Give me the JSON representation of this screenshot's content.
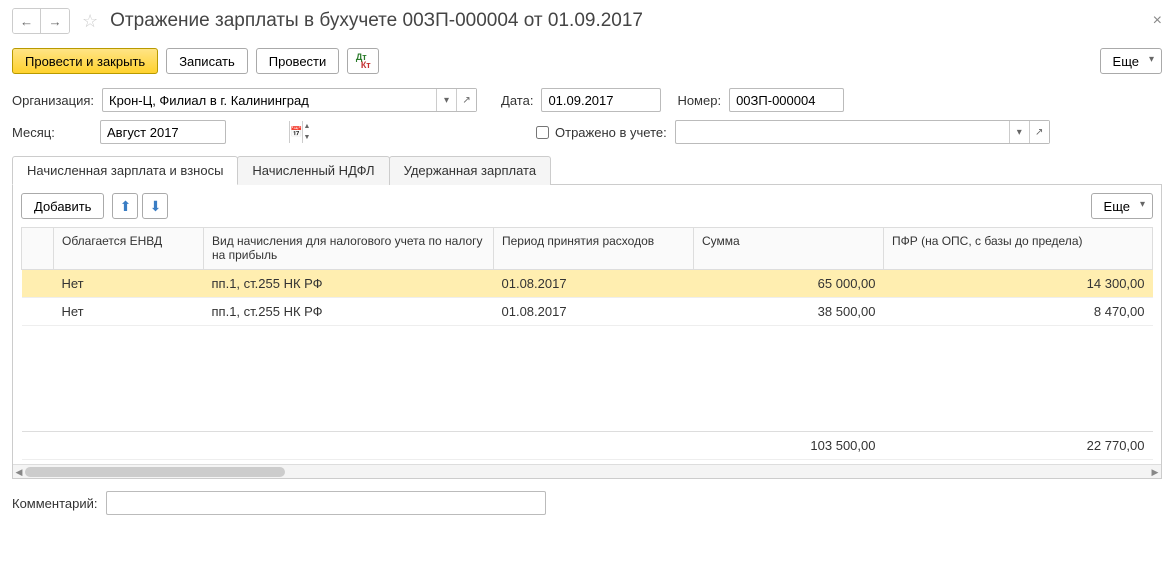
{
  "header": {
    "title": "Отражение зарплаты в бухучете 00ЗП-000004 от 01.09.2017"
  },
  "toolbar": {
    "submit_close": "Провести и закрыть",
    "save": "Записать",
    "submit": "Провести",
    "more": "Еще"
  },
  "fields": {
    "org_label": "Организация:",
    "org_value": "Крон-Ц, Филиал в г. Калининград",
    "date_label": "Дата:",
    "date_value": "01.09.2017",
    "number_label": "Номер:",
    "number_value": "00ЗП-000004",
    "month_label": "Месяц:",
    "month_value": "Август 2017",
    "accounted_label": "Отражено в учете:",
    "accounted_value": "",
    "comment_label": "Комментарий:",
    "comment_value": ""
  },
  "tabs": [
    {
      "label": "Начисленная зарплата и взносы",
      "active": true
    },
    {
      "label": "Начисленный НДФЛ",
      "active": false
    },
    {
      "label": "Удержанная зарплата",
      "active": false
    }
  ],
  "table_toolbar": {
    "add": "Добавить",
    "more": "Еще"
  },
  "columns": {
    "envd": "Облагается ЕНВД",
    "type": "Вид начисления для налогового учета по налогу на прибыль",
    "period": "Период принятия расходов",
    "sum": "Сумма",
    "pfr": "ПФР (на ОПС, с базы до предела)"
  },
  "rows": [
    {
      "envd": "Нет",
      "type": "пп.1, ст.255 НК РФ",
      "period": "01.08.2017",
      "sum": "65 000,00",
      "pfr": "14 300,00",
      "selected": true
    },
    {
      "envd": "Нет",
      "type": "пп.1, ст.255 НК РФ",
      "period": "01.08.2017",
      "sum": "38 500,00",
      "pfr": "8 470,00",
      "selected": false
    }
  ],
  "totals": {
    "sum": "103 500,00",
    "pfr": "22 770,00"
  }
}
